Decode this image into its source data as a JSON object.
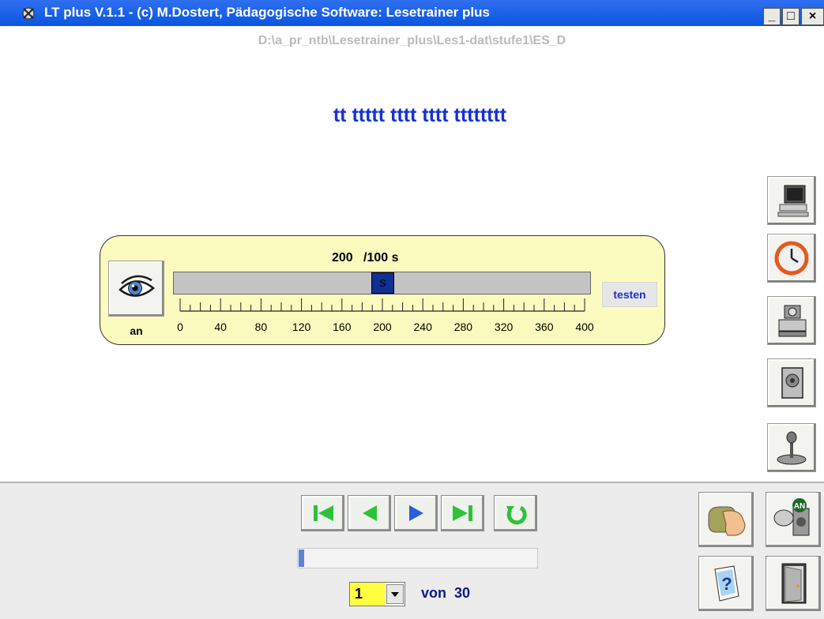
{
  "window": {
    "title": "LT plus   V.1.1 - (c) M.Dostert, Pädagogische Software: Lesetrainer plus",
    "minimize": "_",
    "maximize": "□",
    "close": "×"
  },
  "path": "D:\\a_pr_ntb\\Lesetrainer_plus\\Les1-dat\\stufe1\\ES_D",
  "reading_text": "tt ttttt tttt tttt tttttttt",
  "speed_panel": {
    "value": "200",
    "unit": "/100 s",
    "eye_label": "an",
    "thumb_label": "S",
    "slider_value": 200,
    "slider_min": 0,
    "slider_max": 400,
    "scale": [
      "0",
      "40",
      "80",
      "120",
      "160",
      "200",
      "240",
      "280",
      "320",
      "360",
      "400"
    ],
    "test_button": "testen"
  },
  "side_buttons": [
    "computer-icon",
    "clock-icon",
    "printer-icon",
    "speaker-icon",
    "joystick-icon"
  ],
  "navigation": {
    "buttons": [
      "first-icon",
      "previous-icon",
      "play-icon",
      "last-icon",
      "repeat-icon"
    ],
    "progress": 0.02,
    "page_current": "1",
    "page_of": "von",
    "page_total": "30"
  },
  "bottom_right_buttons": [
    "mouse-hand-icon",
    "sound-on-icon",
    "help-icon",
    "exit-door-icon"
  ],
  "sound_on_badge": "AN",
  "help_glyph": "?",
  "colors": {
    "titlebar": "#0a55e0",
    "reading_text": "#1531d4",
    "panel": "#fbfbbf",
    "nav_green": "#2ec23a",
    "nav_blue": "#2a5ed8"
  }
}
